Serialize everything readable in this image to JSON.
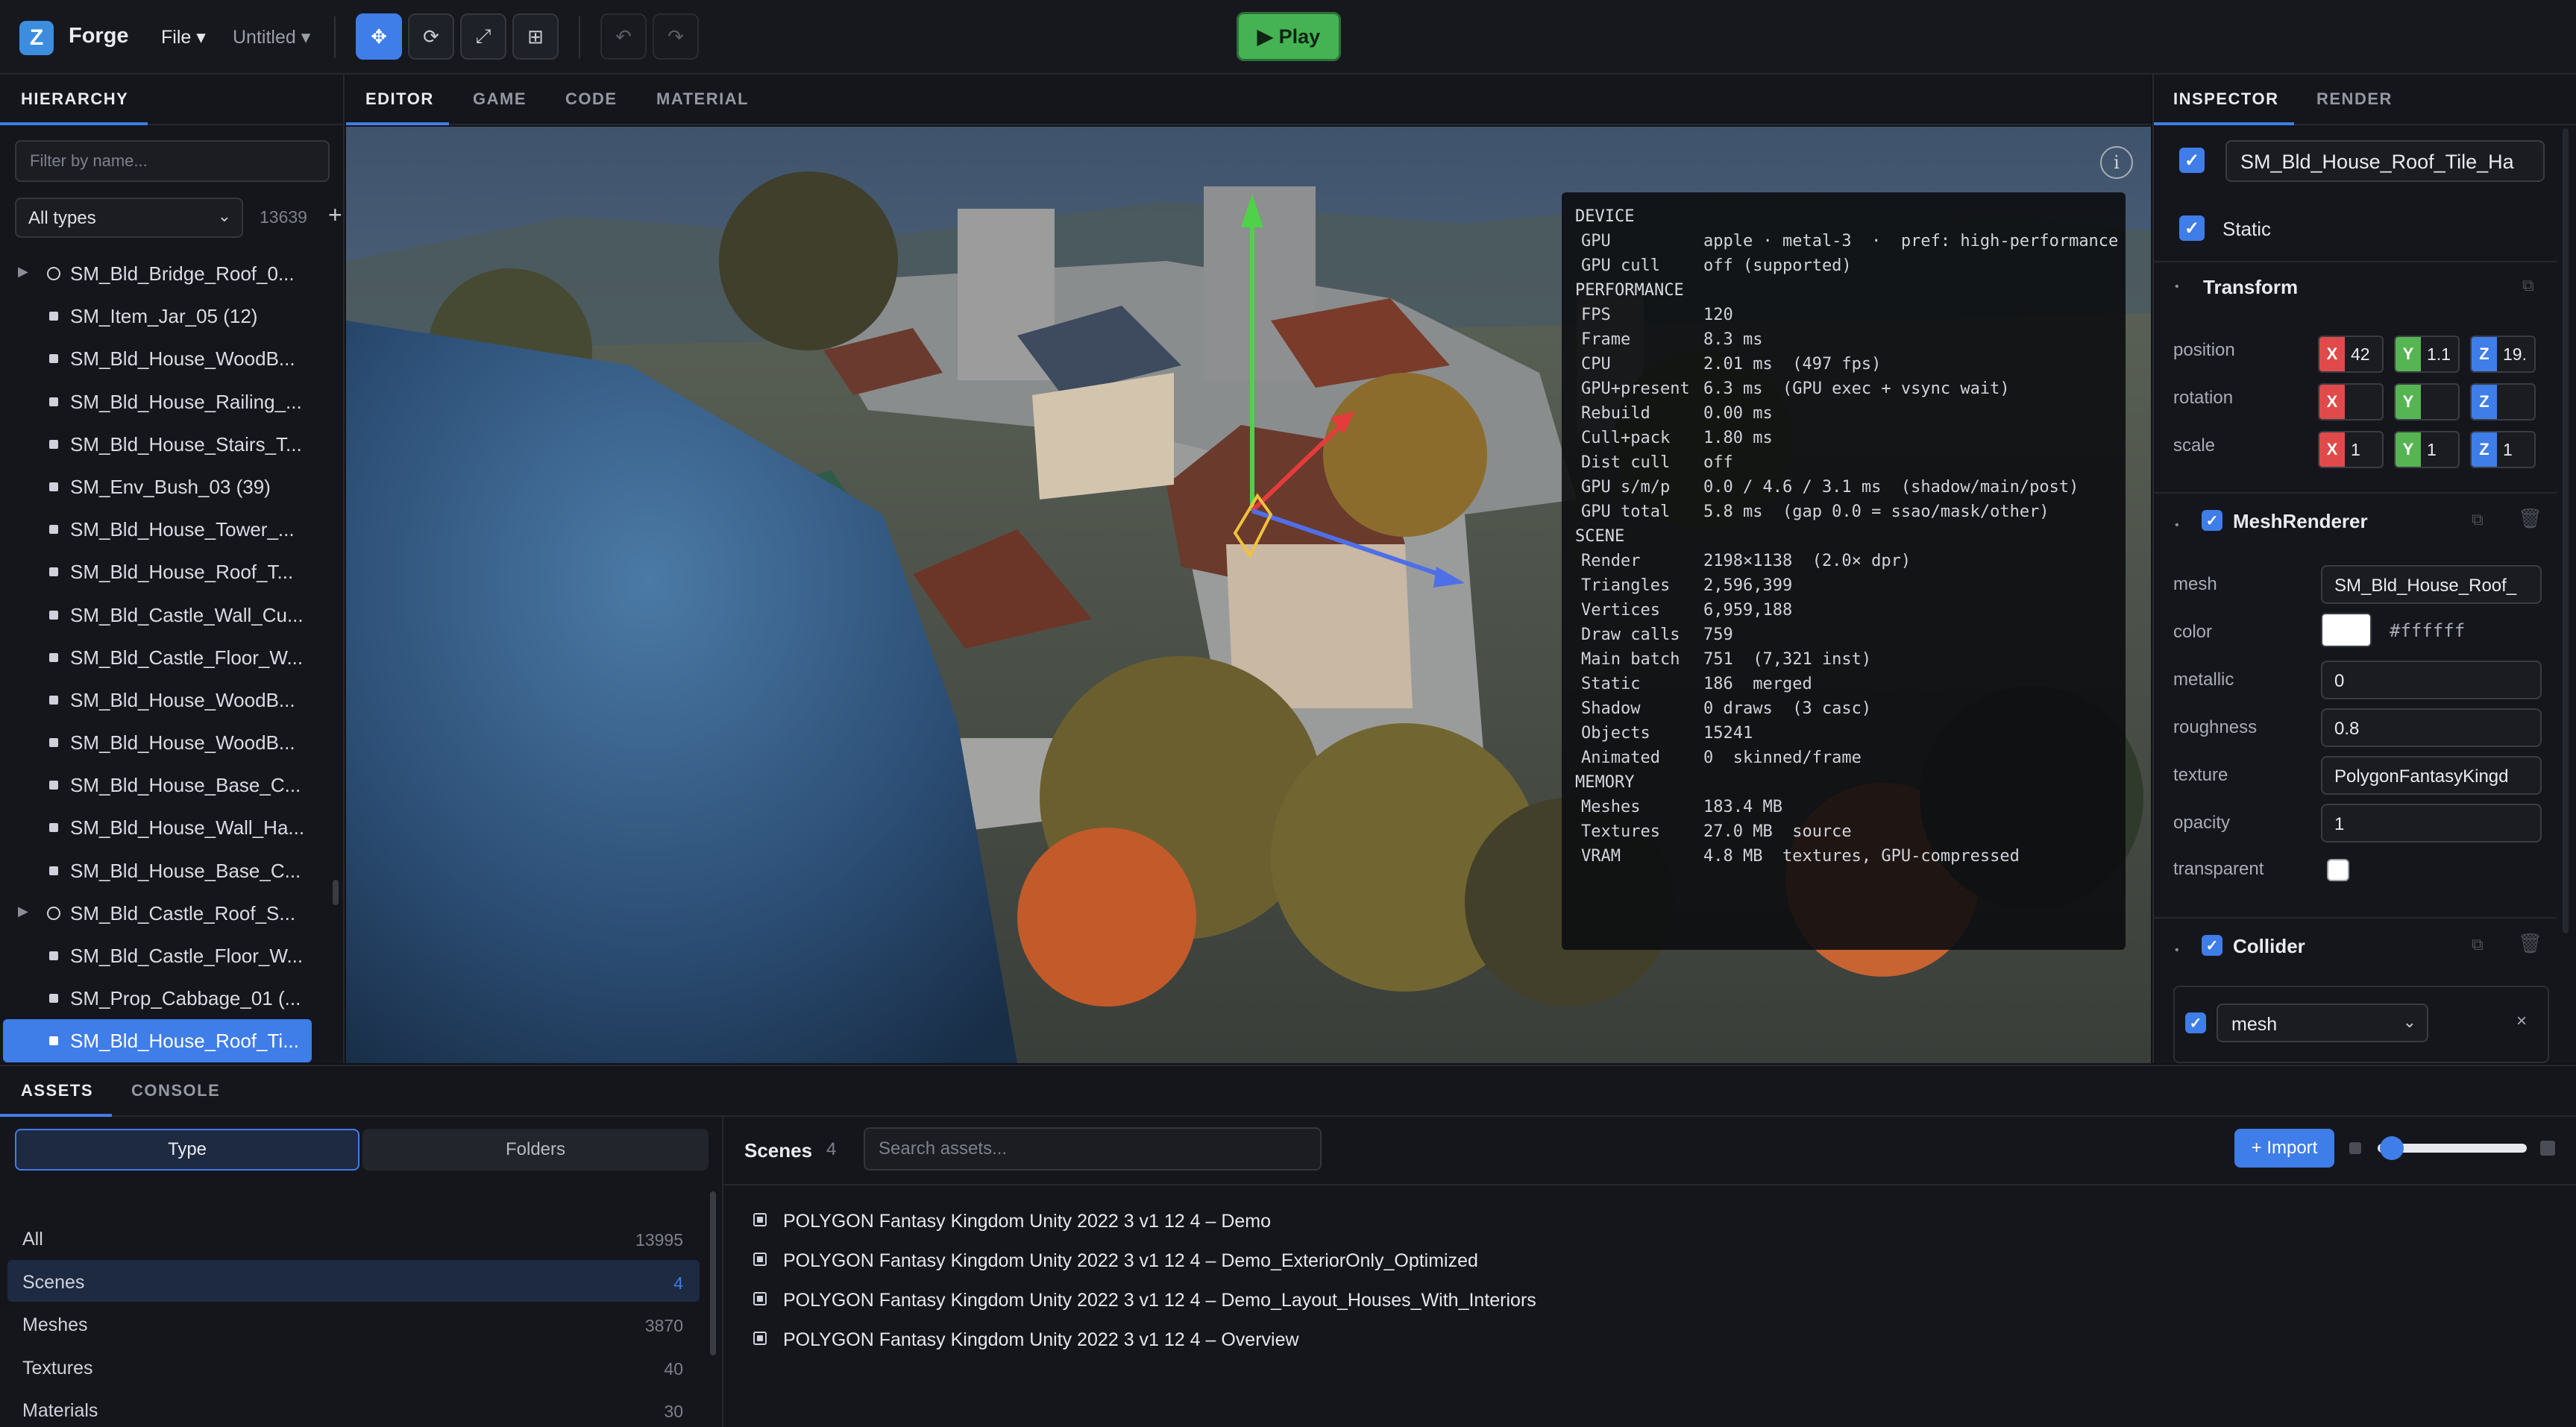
{
  "app": {
    "name": "Forge",
    "file_menu": "File ▾",
    "doc_title": "Untitled ▾",
    "play_label": "Play"
  },
  "icons": {
    "logo": "cube-logo-icon",
    "tools": [
      "move-icon",
      "rotate-icon",
      "scale-icon",
      "rect-icon"
    ],
    "history": [
      "undo-icon",
      "redo-icon"
    ]
  },
  "colors": {
    "accent": "#3f7de8",
    "play": "#45b354",
    "axis_x": "#e04a4a",
    "axis_y": "#56b552",
    "axis_z": "#3f7de8"
  },
  "hierarchy": {
    "tab": "HIERARCHY",
    "filter_placeholder": "Filter by name...",
    "type_filter": "All types",
    "count": "13639",
    "add_label": "+",
    "items": [
      {
        "label": "SM_Bld_Bridge_Roof_0...",
        "kind": "group"
      },
      {
        "label": "SM_Item_Jar_05 (12)",
        "kind": "mesh"
      },
      {
        "label": "SM_Bld_House_WoodB...",
        "kind": "mesh"
      },
      {
        "label": "SM_Bld_House_Railing_...",
        "kind": "mesh"
      },
      {
        "label": "SM_Bld_House_Stairs_T...",
        "kind": "mesh"
      },
      {
        "label": "SM_Env_Bush_03 (39)",
        "kind": "mesh"
      },
      {
        "label": "SM_Bld_House_Tower_...",
        "kind": "mesh"
      },
      {
        "label": "SM_Bld_House_Roof_T...",
        "kind": "mesh"
      },
      {
        "label": "SM_Bld_Castle_Wall_Cu...",
        "kind": "mesh"
      },
      {
        "label": "SM_Bld_Castle_Floor_W...",
        "kind": "mesh"
      },
      {
        "label": "SM_Bld_House_WoodB...",
        "kind": "mesh"
      },
      {
        "label": "SM_Bld_House_WoodB...",
        "kind": "mesh"
      },
      {
        "label": "SM_Bld_House_Base_C...",
        "kind": "mesh"
      },
      {
        "label": "SM_Bld_House_Wall_Ha...",
        "kind": "mesh"
      },
      {
        "label": "SM_Bld_House_Base_C...",
        "kind": "mesh"
      },
      {
        "label": "SM_Bld_Castle_Roof_S...",
        "kind": "group"
      },
      {
        "label": "SM_Bld_Castle_Floor_W...",
        "kind": "mesh"
      },
      {
        "label": "SM_Prop_Cabbage_01 (...",
        "kind": "mesh"
      },
      {
        "label": "SM_Bld_House_Roof_Ti...",
        "kind": "mesh",
        "selected": true
      }
    ]
  },
  "viewport": {
    "tabs": [
      "EDITOR",
      "GAME",
      "CODE",
      "MATERIAL"
    ],
    "stats": [
      {
        "h": "DEVICE"
      },
      {
        "k": "GPU",
        "v": "apple · metal-3  ·  pref: high-performance"
      },
      {
        "k": "GPU cull",
        "v": "off (supported)"
      },
      {
        "h": "PERFORMANCE"
      },
      {
        "k": "FPS",
        "v": "120"
      },
      {
        "k": "Frame",
        "v": "8.3 ms"
      },
      {
        "k": "CPU",
        "v": "2.01 ms  (497 fps)"
      },
      {
        "k": "GPU+present",
        "v": "6.3 ms  (GPU exec + vsync wait)"
      },
      {
        "k": "Rebuild",
        "v": "0.00 ms"
      },
      {
        "k": "Cull+pack",
        "v": "1.80 ms"
      },
      {
        "k": "Dist cull",
        "v": "off"
      },
      {
        "k": "GPU s/m/p",
        "v": "0.0 / 4.6 / 3.1 ms  (shadow/main/post)"
      },
      {
        "k": "GPU total",
        "v": "5.8 ms  (gap 0.0 = ssao/mask/other)"
      },
      {
        "h": "SCENE"
      },
      {
        "k": "Render",
        "v": "2198×1138  (2.0× dpr)"
      },
      {
        "k": "Triangles",
        "v": "2,596,399"
      },
      {
        "k": "Vertices",
        "v": "6,959,188"
      },
      {
        "k": "Draw calls",
        "v": "759"
      },
      {
        "k": "Main batch",
        "v": "751  (7,321 inst)"
      },
      {
        "k": "Static",
        "v": "186  merged"
      },
      {
        "k": "Shadow",
        "v": "0 draws  (3 casc)"
      },
      {
        "k": "Objects",
        "v": "15241"
      },
      {
        "k": "Animated",
        "v": "0  skinned/frame"
      },
      {
        "h": "MEMORY"
      },
      {
        "k": "Meshes",
        "v": "183.4 MB"
      },
      {
        "k": "Textures",
        "v": "27.0 MB  source"
      },
      {
        "k": "VRAM",
        "v": "4.8 MB  textures, GPU-compressed"
      }
    ]
  },
  "inspector": {
    "tabs": [
      "INSPECTOR",
      "RENDER"
    ],
    "object_name": "SM_Bld_House_Roof_Tile_Ha",
    "static_label": "Static",
    "transform": {
      "title": "Transform",
      "position_label": "position",
      "position": [
        "42",
        "1.1",
        "19."
      ],
      "rotation_label": "rotation",
      "rotation": [
        "",
        "",
        ""
      ],
      "scale_label": "scale",
      "scale": [
        "1",
        "1",
        "1"
      ],
      "axes": [
        "X",
        "Y",
        "Z"
      ]
    },
    "mesh_renderer": {
      "title": "MeshRenderer",
      "mesh_label": "mesh",
      "mesh": "SM_Bld_House_Roof_",
      "color_label": "color",
      "color": "#ffffff",
      "metallic_label": "metallic",
      "metallic": "0",
      "roughness_label": "roughness",
      "roughness": "0.8",
      "texture_label": "texture",
      "texture": "PolygonFantasyKingd",
      "opacity_label": "opacity",
      "opacity": "1",
      "transparent_label": "transparent"
    },
    "collider": {
      "title": "Collider",
      "type": "mesh"
    }
  },
  "assets": {
    "tabs": [
      "ASSETS",
      "CONSOLE"
    ],
    "view_type": "Type",
    "view_folders": "Folders",
    "categories": [
      {
        "label": "All",
        "count": "13995"
      },
      {
        "label": "Scenes",
        "count": "4",
        "selected": true
      },
      {
        "label": "Meshes",
        "count": "3870"
      },
      {
        "label": "Textures",
        "count": "40"
      },
      {
        "label": "Materials",
        "count": "30"
      }
    ],
    "section_title": "Scenes",
    "section_count": "4",
    "search_placeholder": "Search assets...",
    "import_label": "+ Import",
    "thumb_size": 0.02,
    "scenes": [
      "POLYGON Fantasy Kingdom Unity 2022 3 v1 12 4 – Demo",
      "POLYGON Fantasy Kingdom Unity 2022 3 v1 12 4 – Demo_ExteriorOnly_Optimized",
      "POLYGON Fantasy Kingdom Unity 2022 3 v1 12 4 – Demo_Layout_Houses_With_Interiors",
      "POLYGON Fantasy Kingdom Unity 2022 3 v1 12 4 – Overview"
    ]
  }
}
